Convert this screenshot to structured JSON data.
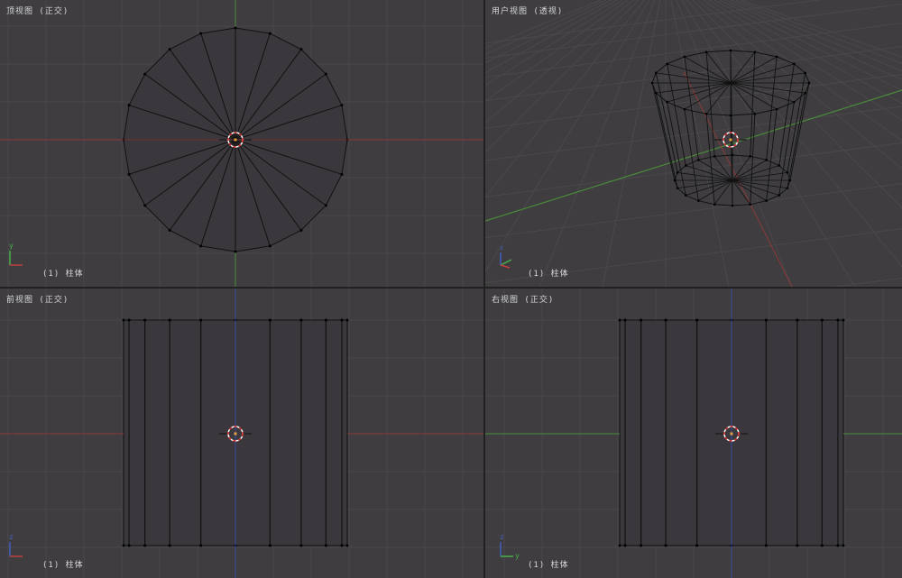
{
  "viewports": {
    "top": {
      "title": "顶视图 (正交)",
      "info": "(1) 柱体"
    },
    "user": {
      "title": "用户视图 (透视)",
      "info": "(1) 柱体"
    },
    "front": {
      "title": "前视图 (正交)",
      "info": "(1) 柱体"
    },
    "right": {
      "title": "右视图 (正交)",
      "info": "(1) 柱体"
    }
  },
  "gizmo_labels": {
    "x": "x",
    "y": "y",
    "z": "z"
  },
  "mesh": {
    "segments": 20
  },
  "colors": {
    "viewport_bg": "#3f3d40",
    "grid": "#4a484b",
    "axis_x": "#8a3a3a",
    "axis_y": "#4a8a3a",
    "axis_z": "#3a4aa0",
    "wire": "#111111",
    "cursor_white": "#ffffff",
    "cursor_red": "#d02020"
  }
}
